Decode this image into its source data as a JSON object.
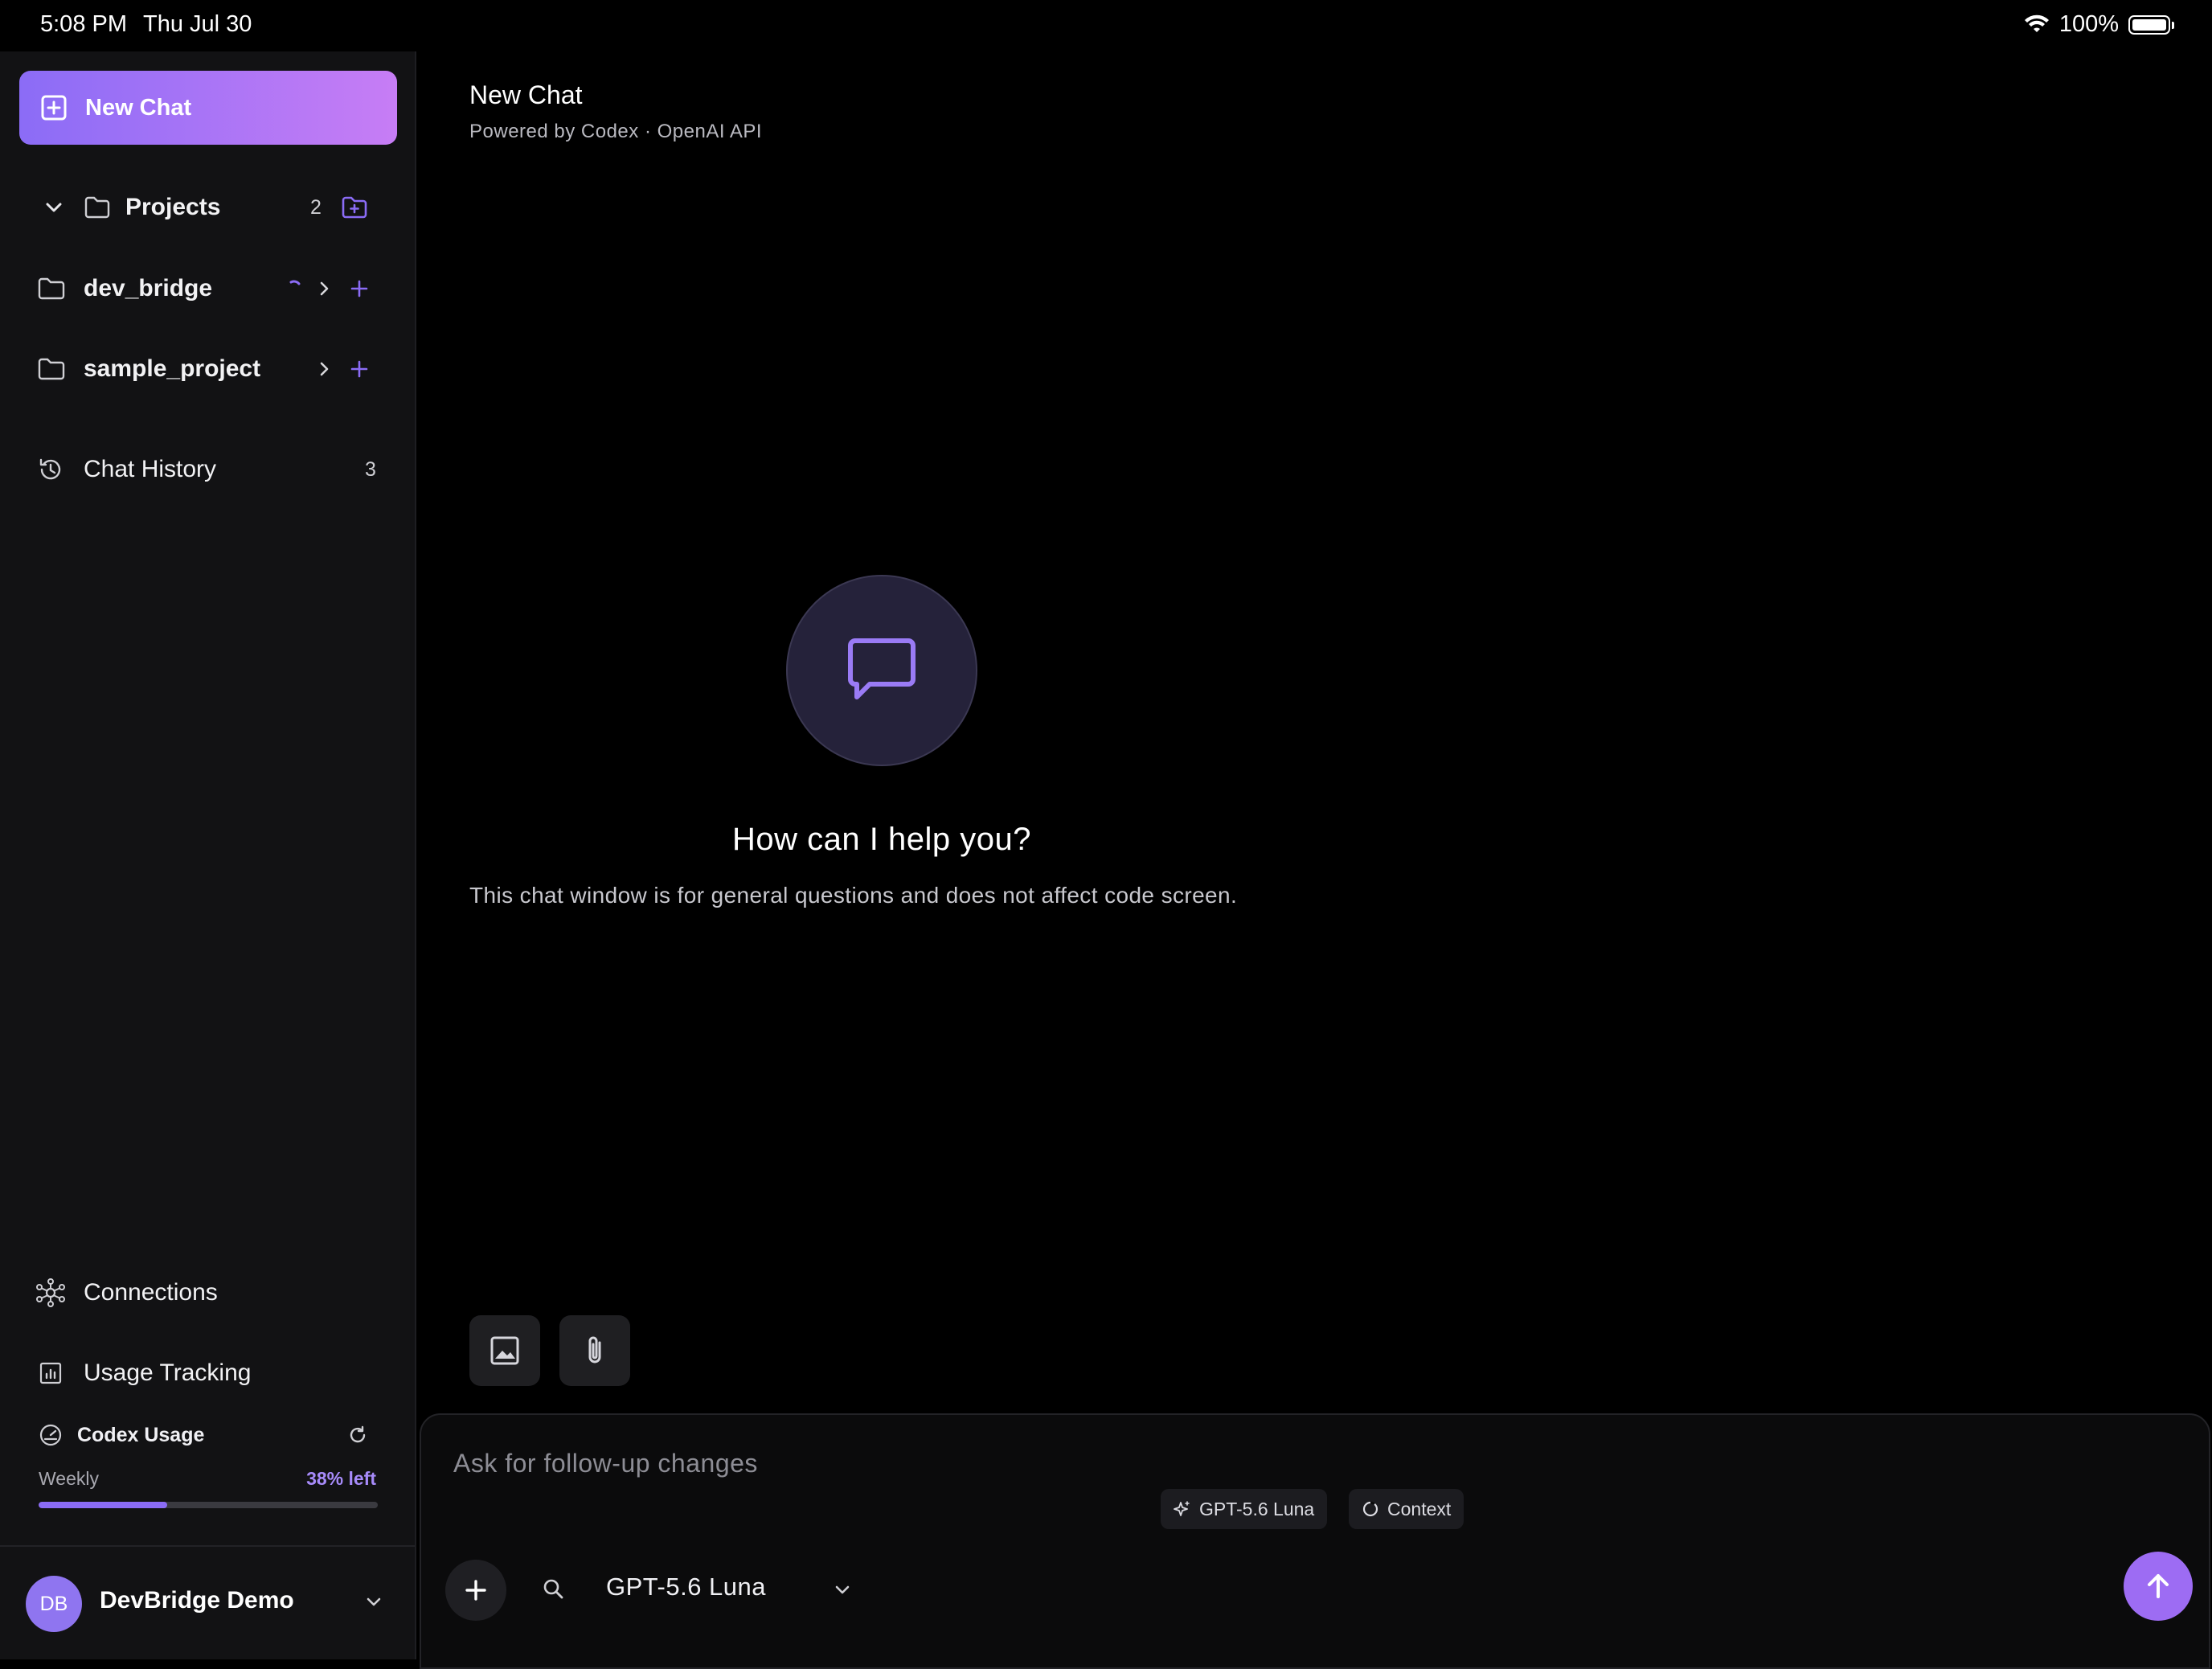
{
  "status_bar": {
    "time": "5:08 PM",
    "date": "Thu Jul 30",
    "battery": "100%",
    "battery_level": 1.0
  },
  "sidebar": {
    "new_chat_label": "New Chat",
    "projects": {
      "label": "Projects",
      "count": "2"
    },
    "project_items": [
      {
        "label": "dev_bridge",
        "loading": true
      },
      {
        "label": "sample_project",
        "loading": false
      }
    ],
    "chat_history": {
      "label": "Chat History",
      "count": "3"
    },
    "connections_label": "Connections",
    "usage_tracking_label": "Usage Tracking",
    "codex_usage": {
      "title": "Codex Usage",
      "period": "Weekly",
      "remaining_label": "38% left",
      "used_fraction": 0.38
    },
    "account": {
      "initials": "DB",
      "name": "DevBridge Demo"
    }
  },
  "main": {
    "title": "New Chat",
    "subtitle": "Powered by Codex · OpenAI API",
    "empty_state": {
      "heading": "How can I help you?",
      "description": "This chat window is for general questions and does not affect code screen."
    },
    "composer": {
      "placeholder": "Ask for follow-up changes",
      "chips": [
        "GPT-5.6 Luna",
        "Context"
      ],
      "model_name": "GPT-5.6 Luna"
    }
  },
  "colors": {
    "accent": "#8b6cf6",
    "accent_end": "#c77df5",
    "sidebar_bg": "#121214",
    "main_bg": "#000000"
  }
}
